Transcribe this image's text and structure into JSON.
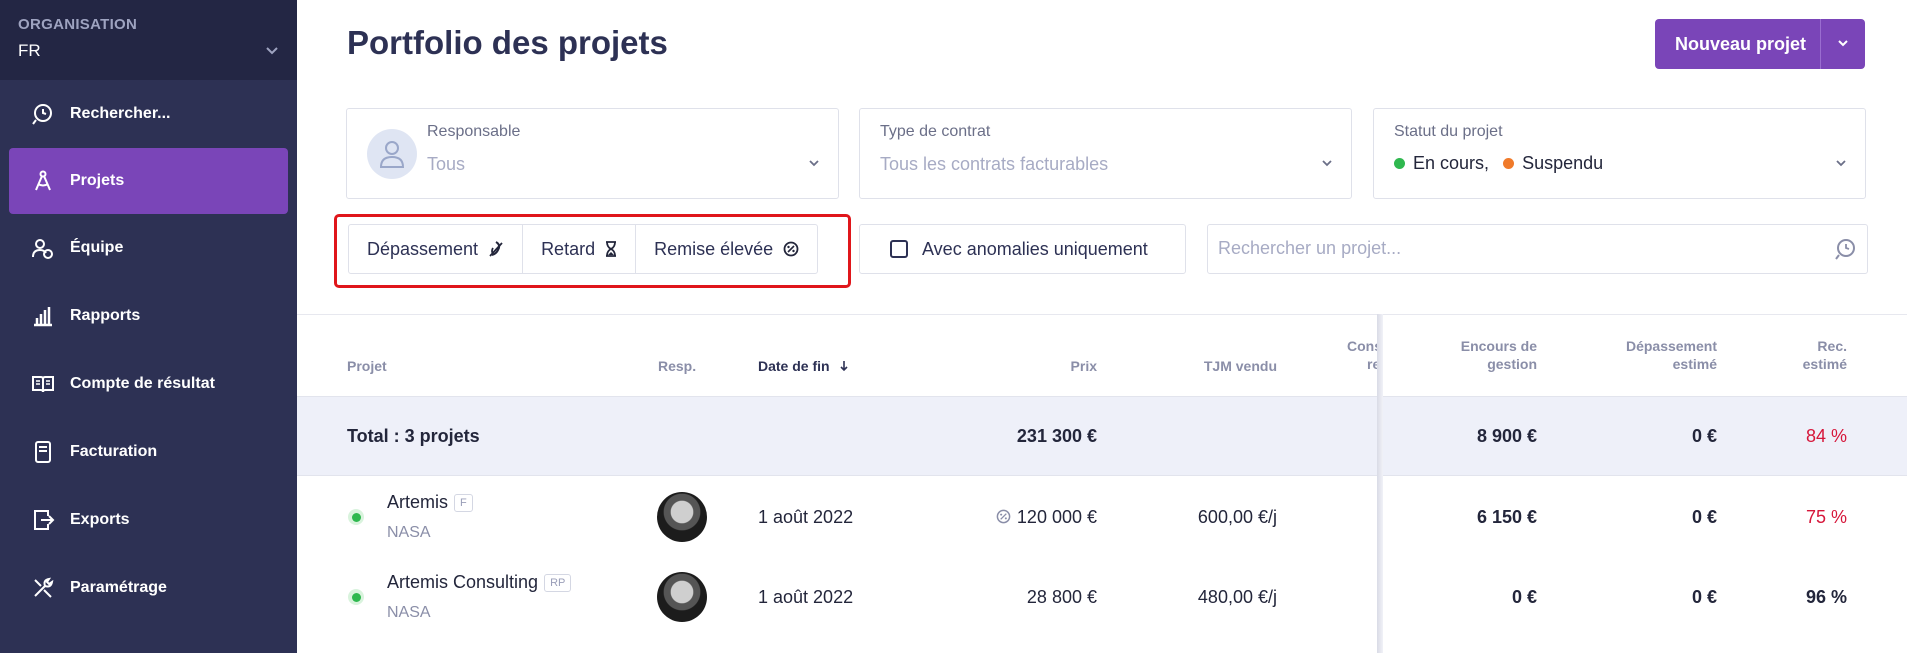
{
  "sidebar": {
    "org_label": "ORGANISATION",
    "org_value": "FR",
    "items": [
      {
        "label": "Rechercher...",
        "icon": "search-icon"
      },
      {
        "label": "Projets",
        "icon": "compass-icon",
        "active": true
      },
      {
        "label": "Équipe",
        "icon": "users-icon"
      },
      {
        "label": "Rapports",
        "icon": "bar-chart-icon"
      },
      {
        "label": "Compte de résultat",
        "icon": "book-icon"
      },
      {
        "label": "Facturation",
        "icon": "invoice-icon"
      },
      {
        "label": "Exports",
        "icon": "export-icon"
      },
      {
        "label": "Paramétrage",
        "icon": "tools-icon"
      }
    ]
  },
  "header": {
    "title": "Portfolio des projets",
    "new_button": "Nouveau projet"
  },
  "filters": {
    "manager": {
      "label": "Responsable",
      "value": "Tous"
    },
    "contract": {
      "label": "Type de contrat",
      "value": "Tous les contrats facturables"
    },
    "status": {
      "label": "Statut du projet",
      "values": [
        {
          "text": "En cours",
          "sep": ",",
          "color": "#2fb84f"
        },
        {
          "text": "Suspendu",
          "color": "#f07a2a"
        }
      ]
    },
    "chips": [
      "Dépassement",
      "Retard",
      "Remise élevée"
    ],
    "anomalies_label": "Avec anomalies uniquement",
    "search_placeholder": "Rechercher un projet..."
  },
  "table": {
    "headers": {
      "project": "Projet",
      "resp": "Resp.",
      "end_date": "Date de fin",
      "price": "Prix",
      "tjm": "TJM vendu",
      "cons_1": "Cons",
      "cons_2": "re",
      "encours_1": "Encours de",
      "encours_2": "gestion",
      "depassement_1": "Dépassement",
      "depassement_2": "estimé",
      "rec_1": "Rec.",
      "rec_2": "estimé"
    },
    "total": {
      "label": "Total : 3 projets",
      "price": "231 300 €",
      "encours": "8 900 €",
      "depassement": "0 €",
      "rec": "84 %"
    },
    "rows": [
      {
        "name": "Artemis",
        "tag": "F",
        "client": "NASA",
        "end_date": "1 août 2022",
        "price": "120 000 €",
        "tjm": "600,00 €/j",
        "encours": "6 150 €",
        "depassement": "0 €",
        "rec": "75 %"
      },
      {
        "name": "Artemis Consulting",
        "tag": "RP",
        "client": "NASA",
        "end_date": "1 août 2022",
        "price": "28 800 €",
        "tjm": "480,00 €/j",
        "encours": "0 €",
        "depassement": "0 €",
        "rec": "96 %"
      }
    ]
  }
}
